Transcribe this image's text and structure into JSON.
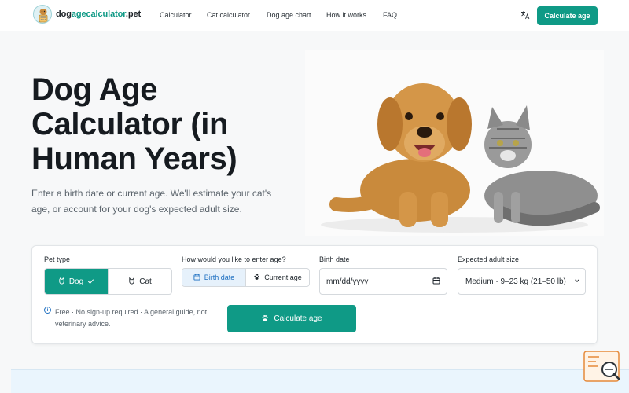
{
  "header": {
    "brand_part1": "dog",
    "brand_part2": "agecalculator",
    "brand_part3": ".pet",
    "nav": [
      "Calculator",
      "Cat calculator",
      "Dog age chart",
      "How it works",
      "FAQ"
    ],
    "cta": "Calculate age"
  },
  "hero": {
    "title": "Dog Age Calculator (in Human Years)",
    "subtitle": "Enter a birth date or current age. We'll estimate your cat's age, or account for your dog's expected adult size."
  },
  "form": {
    "pet_type_label": "Pet type",
    "pet_options": [
      "Dog",
      "Cat"
    ],
    "pet_selected": "Dog",
    "entry_label": "How would you like to enter age?",
    "entry_options": [
      "Birth date",
      "Current age"
    ],
    "entry_selected": "Birth date",
    "birth_date_label": "Birth date",
    "birth_date_placeholder": "mm/dd/yyyy",
    "size_label": "Expected adult size",
    "size_value": "Medium · 9–23 kg (21–50 lb)",
    "note": "Free · No sign-up required · A general guide, not veterinary advice.",
    "submit": "Calculate age"
  },
  "colors": {
    "accent": "#0f9a86",
    "selected_blue": "#1d6fc1"
  }
}
